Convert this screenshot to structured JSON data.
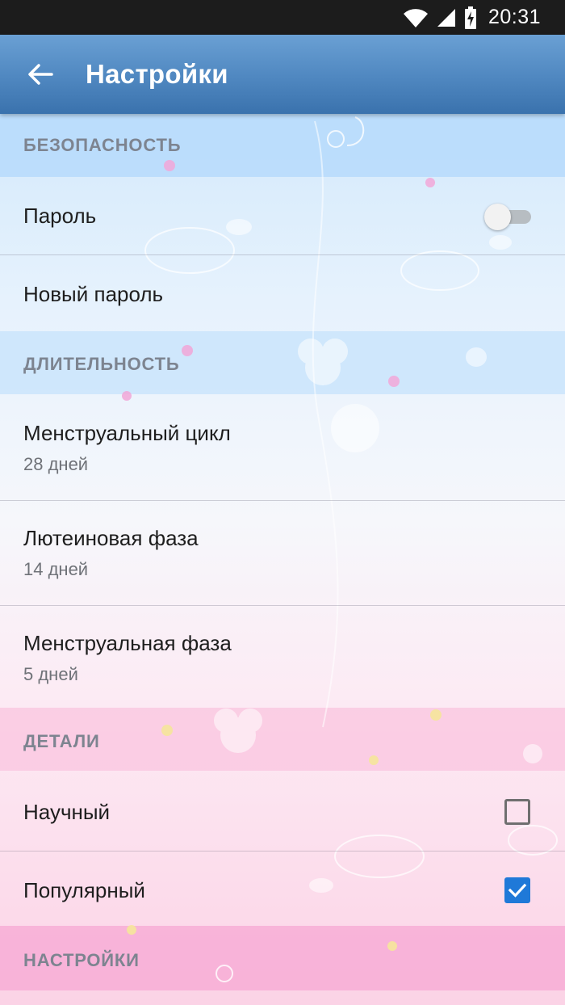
{
  "status_bar": {
    "time": "20:31",
    "icons": [
      "wifi-icon",
      "cellular-signal-icon",
      "battery-charging-icon"
    ]
  },
  "app_bar": {
    "back_icon": "arrow-left-icon",
    "title": "Настройки"
  },
  "sections": {
    "security": {
      "header": "БЕЗОПАСНОСТЬ",
      "password": {
        "title": "Пароль",
        "toggle_on": false
      },
      "new_password": {
        "title": "Новый пароль"
      }
    },
    "duration": {
      "header": "ДЛИТЕЛЬНОСТЬ",
      "menstrual_cycle": {
        "title": "Менструальный цикл",
        "value": "28 дней"
      },
      "luteal_phase": {
        "title": "Лютеиновая фаза",
        "value": "14 дней"
      },
      "menstrual_phase": {
        "title": "Менструальная фаза",
        "value": "5 дней"
      }
    },
    "details": {
      "header": "ДЕТАЛИ",
      "scientific": {
        "title": "Научный",
        "checked": false
      },
      "popular": {
        "title": "Популярный",
        "checked": true
      }
    },
    "settings": {
      "header": "НАСТРОЙКИ"
    }
  },
  "colors": {
    "app_bar": "#4f87c0",
    "status_bar": "#1c1c1c",
    "checkbox_checked": "#1f79d8",
    "section_header_text": "#7d8490"
  }
}
